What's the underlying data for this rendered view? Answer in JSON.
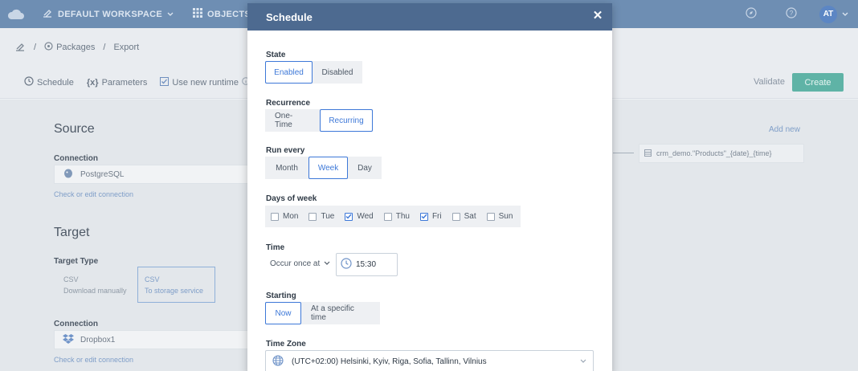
{
  "topbar": {
    "workspace": "DEFAULT WORKSPACE",
    "objects": "OBJECTS",
    "avatar": "AT"
  },
  "breadcrumb": {
    "packages": "Packages",
    "export": "Export"
  },
  "toolbar": {
    "schedule": "Schedule",
    "parameters_prefix": "{x}",
    "parameters": "Parameters",
    "use_new_runtime": "Use new runtime",
    "validate": "Validate",
    "create": "Create"
  },
  "background": {
    "source_title": "Source",
    "connection_label": "Connection",
    "source_connection": "PostgreSQL",
    "check_edit": "Check or edit connection",
    "target_title": "Target",
    "target_type_label": "Target Type",
    "target_types": [
      {
        "name": "CSV",
        "desc": "Download manually"
      },
      {
        "name": "CSV",
        "desc": "To storage service"
      }
    ],
    "target_connection_label": "Connection",
    "target_connection": "Dropbox1",
    "check_edit_2": "Check or edit connection",
    "add_new": "Add new",
    "flow_item": "crm_demo.\"Products\"_{date}_{time}"
  },
  "modal": {
    "title": "Schedule",
    "state": {
      "label": "State",
      "options": [
        "Enabled",
        "Disabled"
      ],
      "selected": "Enabled"
    },
    "recurrence": {
      "label": "Recurrence",
      "options": [
        "One-Time",
        "Recurring"
      ],
      "selected": "Recurring"
    },
    "run_every": {
      "label": "Run every",
      "options": [
        "Month",
        "Week",
        "Day"
      ],
      "selected": "Week"
    },
    "days_of_week": {
      "label": "Days of week",
      "days": [
        {
          "label": "Mon",
          "checked": false
        },
        {
          "label": "Tue",
          "checked": false
        },
        {
          "label": "Wed",
          "checked": true
        },
        {
          "label": "Thu",
          "checked": false
        },
        {
          "label": "Fri",
          "checked": true
        },
        {
          "label": "Sat",
          "checked": false
        },
        {
          "label": "Sun",
          "checked": false
        }
      ]
    },
    "time": {
      "label": "Time",
      "mode": "Occur once at",
      "value": "15:30"
    },
    "starting": {
      "label": "Starting",
      "options": [
        "Now",
        "At a specific time"
      ],
      "selected": "Now"
    },
    "time_zone": {
      "label": "Time Zone",
      "value": "(UTC+02:00) Helsinki, Kyiv, Riga, Sofia, Tallinn, Vilnius"
    }
  },
  "colors": {
    "topbar": "#6e8eb3",
    "modal_header": "#4d6a90",
    "accent": "#3d78d8",
    "create_button": "#5fb3a6"
  }
}
